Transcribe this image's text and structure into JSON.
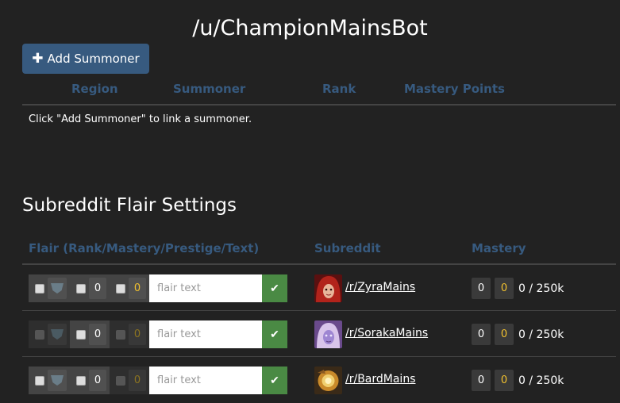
{
  "page": {
    "title": "/u/ChampionMainsBot"
  },
  "summoners": {
    "add_button_label": "Add Summoner",
    "columns": [
      "Region",
      "Summoner",
      "Rank",
      "Mastery Points"
    ],
    "empty_message": "Click \"Add Summoner\" to link a summoner."
  },
  "flair_settings": {
    "title": "Subreddit Flair Settings",
    "columns": {
      "flair": "Flair (Rank/Mastery/Prestige/Text)",
      "subreddit": "Subreddit",
      "mastery": "Mastery"
    },
    "rows": [
      {
        "rank_enabled": true,
        "mastery_enabled": true,
        "prestige_enabled": true,
        "mastery_value": "0",
        "prestige_value": "0",
        "text_placeholder": "flair text",
        "subreddit": "/r/ZyraMains",
        "avatar_icon": "zyra-avatar-icon",
        "mastery_level": "0",
        "mastery_prestige": "0",
        "mastery_points": "0 / 250k"
      },
      {
        "rank_enabled": false,
        "mastery_enabled": true,
        "prestige_enabled": false,
        "mastery_value": "0",
        "prestige_value": "0",
        "text_placeholder": "flair text",
        "subreddit": "/r/SorakaMains",
        "avatar_icon": "soraka-avatar-icon",
        "mastery_level": "0",
        "mastery_prestige": "0",
        "mastery_points": "0 / 250k"
      },
      {
        "rank_enabled": true,
        "mastery_enabled": true,
        "prestige_enabled": false,
        "mastery_value": "0",
        "prestige_value": "0",
        "text_placeholder": "flair text",
        "subreddit": "/r/BardMains",
        "avatar_icon": "bard-avatar-icon",
        "mastery_level": "0",
        "mastery_prestige": "0",
        "mastery_points": "0 / 250k"
      }
    ]
  },
  "colors": {
    "background": "#222222",
    "accent": "#375a7f",
    "save_green": "#4a8a44",
    "gold": "#f0c02e"
  }
}
